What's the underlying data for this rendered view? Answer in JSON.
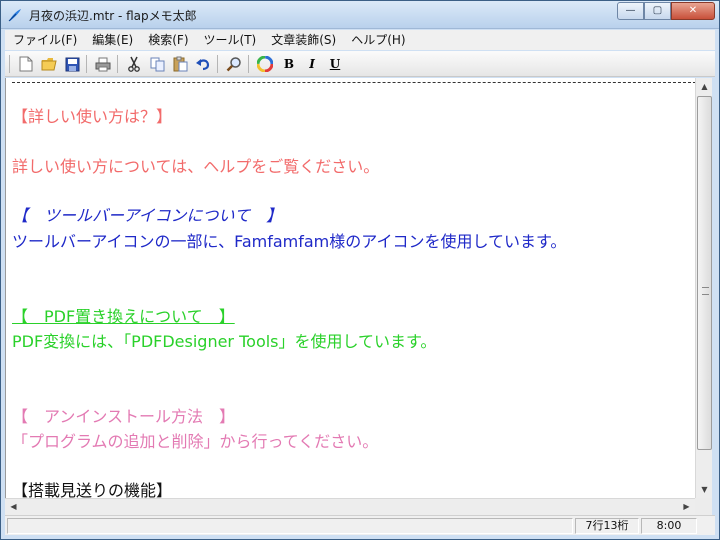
{
  "window": {
    "title": "月夜の浜辺.mtr - flapメモ太郎",
    "controls": {
      "minimize": "—",
      "maximize": "▢",
      "close": "✕"
    }
  },
  "menu": {
    "file": "ファイル(F)",
    "edit": "編集(E)",
    "search": "検索(F)",
    "tools": "ツール(T)",
    "format": "文章装飾(S)",
    "help": "ヘルプ(H)"
  },
  "toolbar": {
    "icons": [
      "new-file-icon",
      "open-folder-icon",
      "save-disk-icon",
      "print-icon",
      "cut-scissors-icon",
      "copy-icon",
      "paste-icon",
      "undo-icon",
      "find-magnifier-icon",
      "color-wheel-icon"
    ],
    "bold": "B",
    "italic": "I",
    "underline": "U"
  },
  "document": {
    "colors": {
      "salmon": "#f26b6b",
      "blue": "#1f29c8",
      "green": "#2ad12a",
      "pink": "#e37ab3",
      "black": "#111111"
    },
    "lines": {
      "h1": "【詳しい使い方は？】",
      "p1": "詳しい使い方については、ヘルプをご覧ください。",
      "h2": "【　ツールバーアイコンについて　】",
      "p2": "ツールバーアイコンの一部に、Famfamfam様のアイコンを使用しています。",
      "h3": "【　PDF置き換えについて　】",
      "p3": "PDF変換には、「PDFDesigner Tools」を使用しています。",
      "h4": "【　アンインストール方法　】",
      "p4": "「プログラムの追加と削除」から行ってください。",
      "h5": "【搭載見送りの機能】"
    }
  },
  "status": {
    "position": "7行13桁",
    "time": "8:00"
  }
}
